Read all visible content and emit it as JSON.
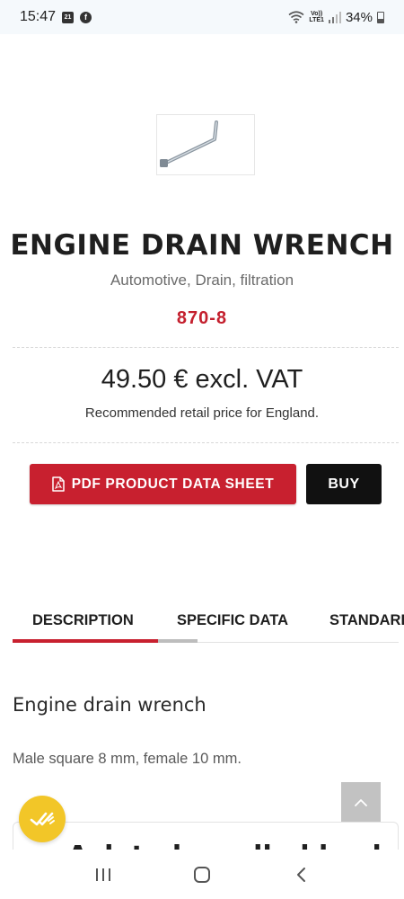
{
  "status_bar": {
    "time": "15:47",
    "calendar_day": "21",
    "battery": "34%",
    "network_top": "Vo))",
    "network_bottom": "LTE1"
  },
  "product": {
    "title": "ENGINE DRAIN WRENCH",
    "category": "Automotive, Drain, filtration",
    "reference": "870-8",
    "price": "49.50 € excl. VAT",
    "price_note": "Recommended retail price for England.",
    "pdf_button": "PDF PRODUCT DATA SHEET",
    "buy_button": "BUY"
  },
  "tabs": [
    {
      "label": "DESCRIPTION",
      "active": true
    },
    {
      "label": "SPECIFIC DATA",
      "active": false
    },
    {
      "label": "STANDARDS",
      "active": false
    }
  ],
  "description": {
    "heading": "Engine drain wrench",
    "text": "Male square 8 mm, female 10 mm."
  },
  "bottom_card": {
    "partial_text": "Ask to be called back"
  },
  "colors": {
    "brand_red": "#c8202f",
    "badge_yellow": "#f2c628",
    "dark": "#111111"
  }
}
